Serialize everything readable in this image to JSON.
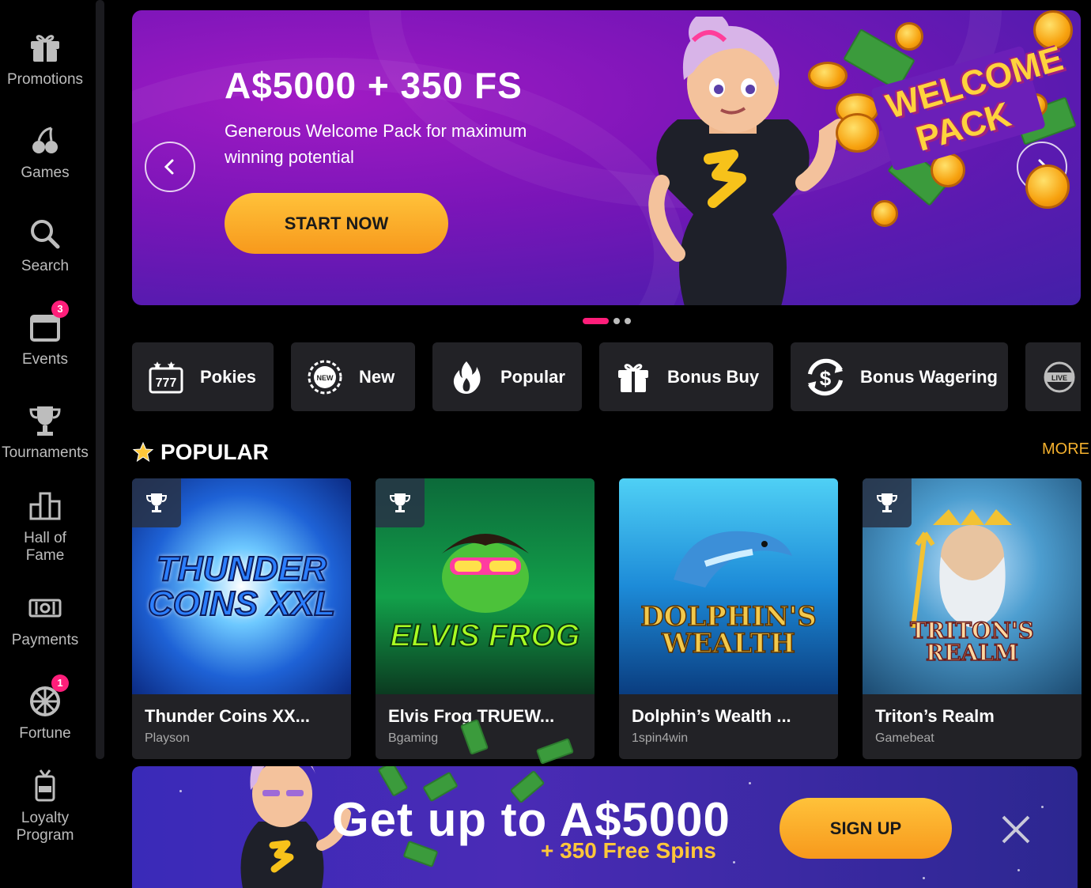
{
  "sidebar": {
    "items": [
      {
        "label": "Promotions",
        "icon": "gift-icon"
      },
      {
        "label": "Games",
        "icon": "cherry-icon"
      },
      {
        "label": "Search",
        "icon": "search-icon"
      },
      {
        "label": "Events",
        "icon": "calendar-icon",
        "badge": "3"
      },
      {
        "label": "Tournaments",
        "icon": "trophy-icon"
      },
      {
        "label": "Hall of Fame",
        "icon": "podium-icon"
      },
      {
        "label": "Payments",
        "icon": "cash-icon"
      },
      {
        "label": "Fortune",
        "icon": "wheel-icon",
        "badge": "1"
      },
      {
        "label": "Loyalty Program",
        "icon": "vip-badge-icon"
      }
    ]
  },
  "hero": {
    "title": "A$5000 + 350 FS",
    "subtitle": "Generous Welcome Pack for maximum winning potential",
    "cta": "START NOW",
    "art_text": "WELCOME PACK",
    "slides": 3,
    "active_slide": 1
  },
  "categories": [
    {
      "label": "Pokies",
      "icon": "slot-777-icon"
    },
    {
      "label": "New",
      "icon": "new-badge-icon"
    },
    {
      "label": "Popular",
      "icon": "fire-icon"
    },
    {
      "label": "Bonus Buy",
      "icon": "gift-icon"
    },
    {
      "label": "Bonus Wagering",
      "icon": "dollar-cycle-icon"
    },
    {
      "label": "",
      "icon": "live-icon"
    }
  ],
  "popular": {
    "title": "POPULAR",
    "more": "MORE",
    "games": [
      {
        "name": "Thunder Coins XX...",
        "provider": "Playson",
        "art": "THUNDER COINS XXL"
      },
      {
        "name": "Elvis Frog TRUEW...",
        "provider": "Bgaming",
        "art": "ELVIS FROG"
      },
      {
        "name": "Dolphin’s Wealth ...",
        "provider": "1spin4win",
        "art": "DOLPHIN'S WEALTH"
      },
      {
        "name": "Triton’s Realm",
        "provider": "Gamebeat",
        "art": "TRITON'S REALM"
      }
    ]
  },
  "promo": {
    "title": "Get up to A$5000",
    "subtitle": "+ 350 Free Spins",
    "cta": "SIGN UP"
  },
  "colors": {
    "accent": "#f7a51f",
    "badge": "#ff1e7a",
    "card_bg": "#222226",
    "more_link": "#f5b12e"
  }
}
